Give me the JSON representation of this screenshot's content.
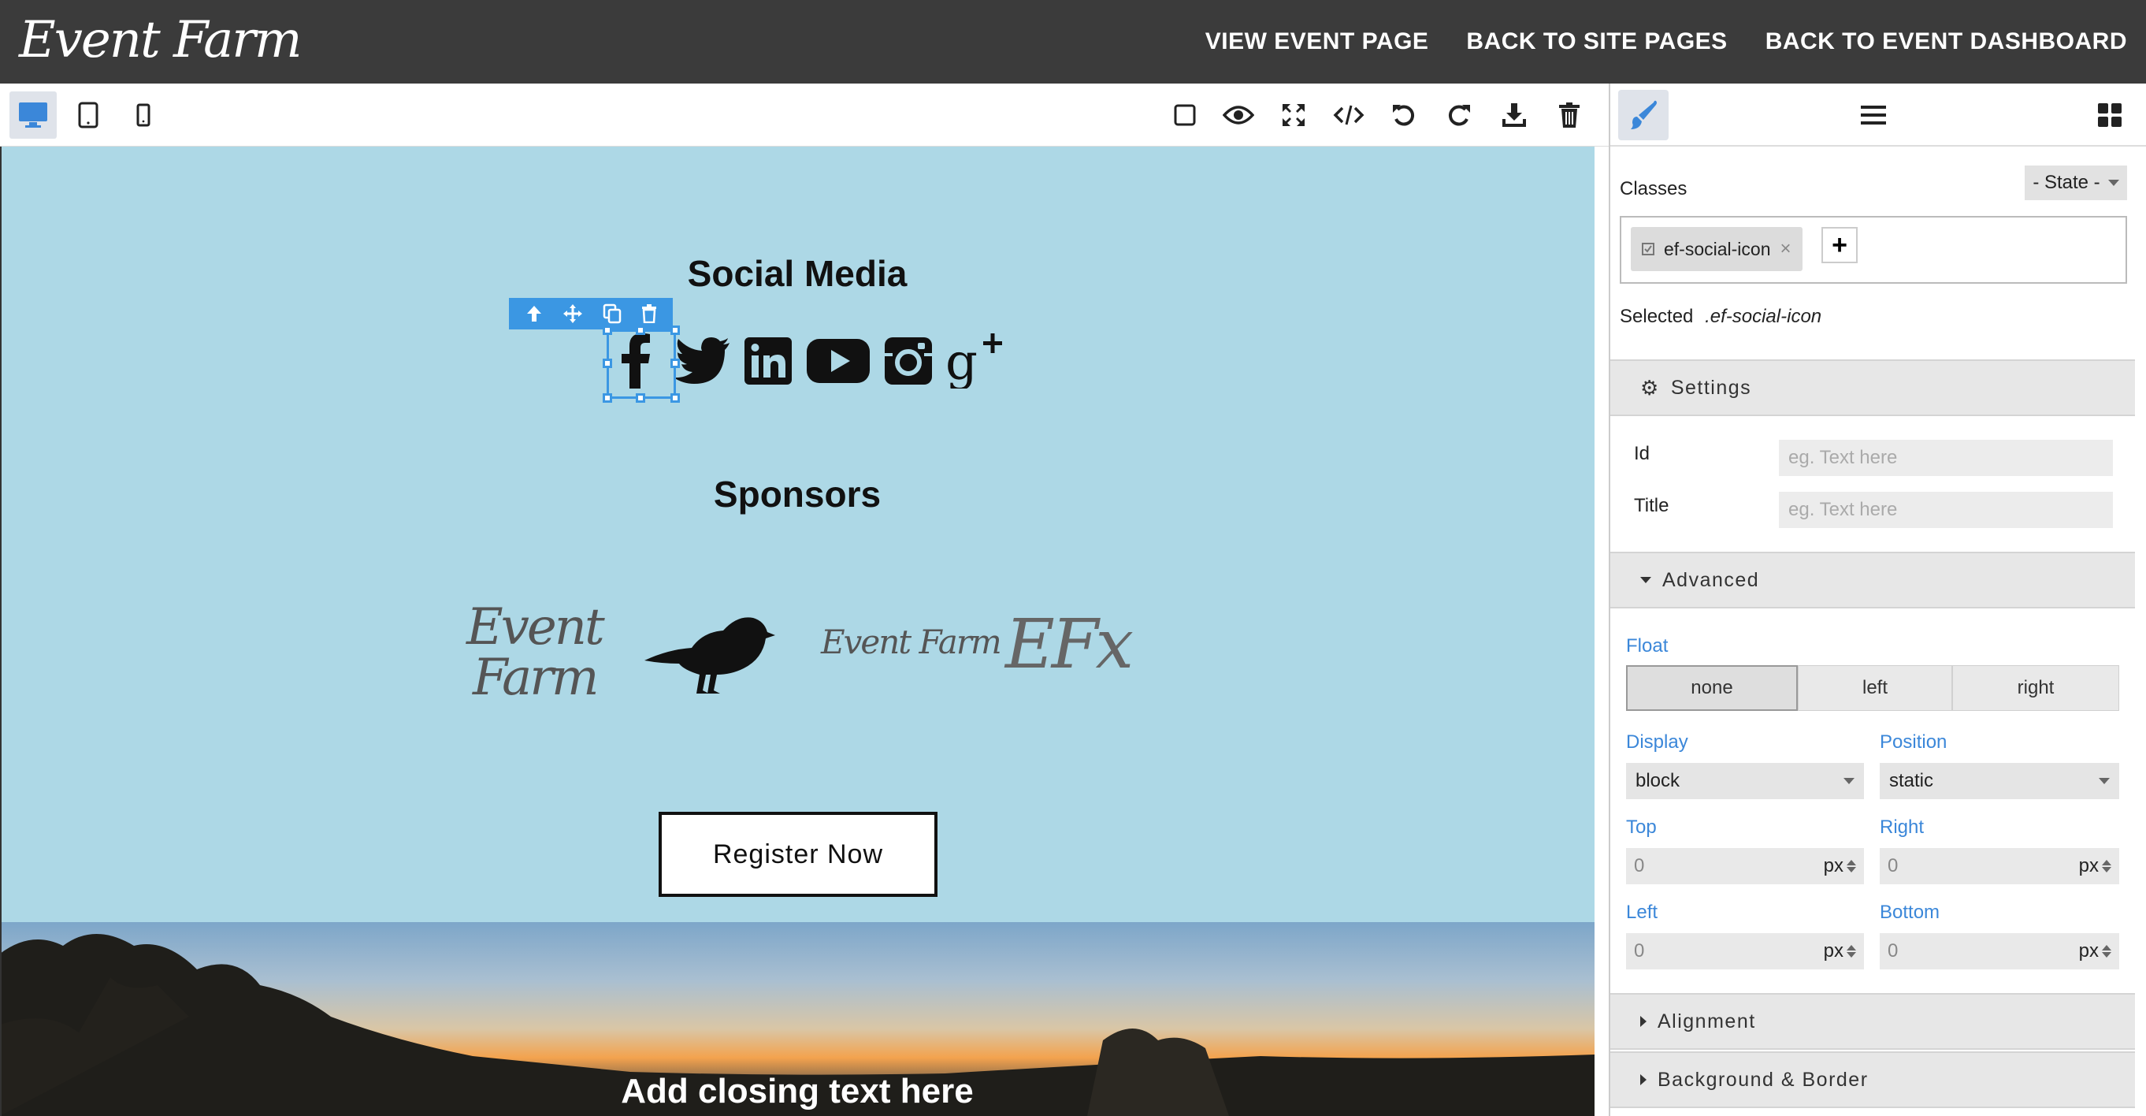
{
  "header": {
    "logo_text": "Event Farm",
    "links": [
      "VIEW EVENT PAGE",
      "BACK TO SITE PAGES",
      "BACK TO EVENT DASHBOARD"
    ]
  },
  "toolbar": {
    "devices": [
      "desktop-icon",
      "tablet-icon",
      "mobile-icon"
    ],
    "tools": [
      "square-outline-icon",
      "eye-icon",
      "fullscreen-icon",
      "code-icon",
      "undo-icon",
      "redo-icon",
      "download-icon",
      "trash-icon"
    ]
  },
  "canvas": {
    "social_title": "Social Media",
    "sponsors_title": "Sponsors",
    "register_label": "Register Now",
    "closing_text": "Add closing text here",
    "sponsor_logo_efx": "EFx",
    "sponsor_logo_eventfarm_small": "Event Farm",
    "sponsor_logo_eventfarm_stacked_1": "Event",
    "sponsor_logo_eventfarm_stacked_2": "Farm"
  },
  "panel": {
    "classes_label": "Classes",
    "state_label": "- State -",
    "class_tag": "ef-social-icon",
    "selected_label": "Selected",
    "selected_value": ".ef-social-icon",
    "settings_label": "Settings",
    "id_label": "Id",
    "id_placeholder": "eg. Text here",
    "title_label": "Title",
    "title_placeholder": "eg. Text here",
    "advanced_label": "Advanced",
    "float_label": "Float",
    "float_options": [
      "none",
      "left",
      "right"
    ],
    "display_label": "Display",
    "display_value": "block",
    "position_label": "Position",
    "position_value": "static",
    "top_label": "Top",
    "right_label": "Right",
    "left_label": "Left",
    "bottom_label": "Bottom",
    "offset_value": "0",
    "unit": "px",
    "alignment_label": "Alignment",
    "background_label": "Background & Border"
  },
  "colors": {
    "canvas_bg": "#add8e6",
    "accent": "#3b97e3",
    "topbar": "#3b3b3b"
  }
}
